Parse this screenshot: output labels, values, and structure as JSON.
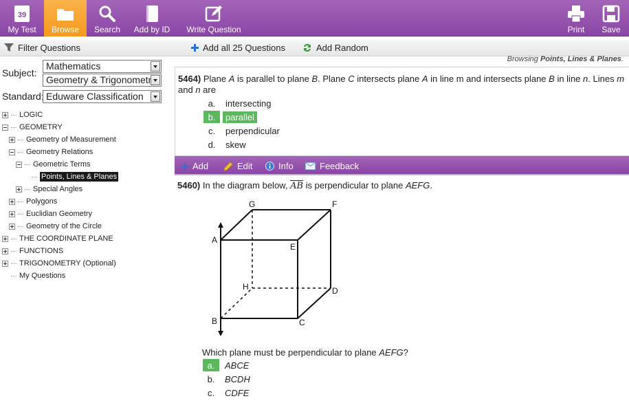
{
  "toolbar": {
    "my_test_badge": "39",
    "my_test": "My Test",
    "browse": "Browse",
    "search": "Search",
    "add_by_id": "Add by ID",
    "write_question": "Write Question",
    "print": "Print",
    "save": "Save",
    "active_color": "#f7a22e",
    "bar_color": "#9a55b2"
  },
  "filter_bar": {
    "filter_questions": "Filter Questions",
    "add_all": "Add all 25 Questions",
    "add_random": "Add Random",
    "browsing_prefix": "Browsing ",
    "browsing_topic": "Points, Lines & Planes",
    "browsing_suffix": "."
  },
  "filters": {
    "subject_label": "Subject:",
    "subject_value": "Mathematics",
    "course_value": "Geometry & Trigonometry",
    "standard_label": "Standard:",
    "standard_value": "Eduware Classification"
  },
  "tree": [
    {
      "label": "LOGIC",
      "state": "plus"
    },
    {
      "label": "GEOMETRY",
      "state": "minus"
    },
    {
      "label": "Geometry of Measurement",
      "state": "plus"
    },
    {
      "label": "Geometry Relations",
      "state": "minus"
    },
    {
      "label": "Geometric Terms",
      "state": "minus"
    },
    {
      "label": "Points, Lines & Planes",
      "state": "leaf-selected"
    },
    {
      "label": "Special Angles",
      "state": "plus"
    },
    {
      "label": "Polygons",
      "state": "plus"
    },
    {
      "label": "Euclidian Geometry",
      "state": "plus"
    },
    {
      "label": "Geometry of the Circle",
      "state": "plus"
    },
    {
      "label": "THE COORDINATE PLANE",
      "state": "plus"
    },
    {
      "label": "FUNCTIONS",
      "state": "plus"
    },
    {
      "label": "TRIGONOMETRY (Optional)",
      "state": "plus"
    },
    {
      "label": "My Questions",
      "state": "leaf"
    }
  ],
  "q1": {
    "number": "5464)",
    "text_html": "Plane <i>A</i> is parallel to plane <i>B</i>. Plane <i>C</i> intersects plane <i>A</i> in line m and intersects plane <i>B</i> in line <i>n</i>. Lines <i>m</i> and <i>n</i> are",
    "choices": [
      {
        "letter": "a.",
        "text": "intersecting",
        "correct": false
      },
      {
        "letter": "b.",
        "text": "parallel",
        "correct": true
      },
      {
        "letter": "c.",
        "text": "perpendicular",
        "correct": false
      },
      {
        "letter": "d.",
        "text": "skew",
        "correct": false
      }
    ]
  },
  "actions": {
    "add": "Add",
    "edit": "Edit",
    "info": "Info",
    "feedback": "Feedback"
  },
  "q2": {
    "number": "5460)",
    "intro": "In the diagram below,",
    "segment": "AB",
    "rest": "is perpendicular to plane",
    "plane": "AEFG",
    "period": ".",
    "prompt_html": "Which plane must be perpendicular to plane <i>AEFG</i>?",
    "diagram_labels": [
      "G",
      "F",
      "A",
      "E",
      "H",
      "D",
      "B",
      "C"
    ],
    "choices": [
      {
        "letter": "a.",
        "text": "ABCE",
        "correct": true
      },
      {
        "letter": "b.",
        "text": "BCDH",
        "correct": false
      },
      {
        "letter": "c.",
        "text": "CDFE",
        "correct": false
      }
    ]
  }
}
